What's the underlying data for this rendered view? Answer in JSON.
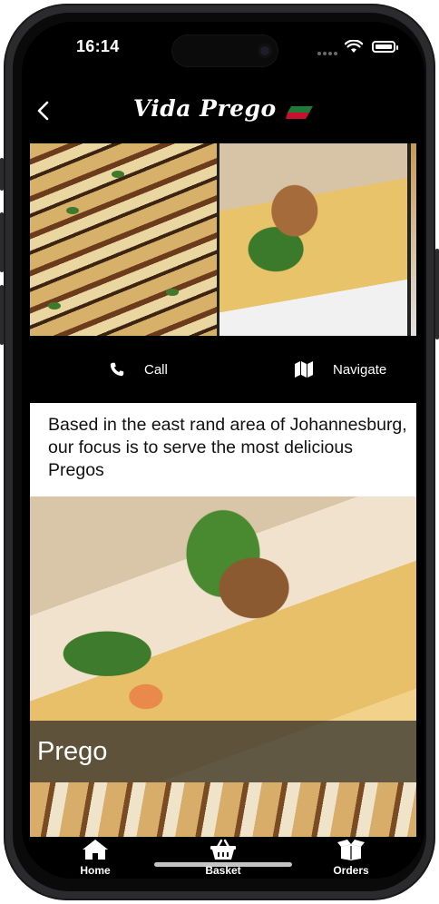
{
  "status_bar": {
    "time": "16:14"
  },
  "header": {
    "brand": "Vida Prego",
    "flag_colors": [
      "#1f7a3a",
      "#c8102e"
    ]
  },
  "actions": {
    "call_label": "Call",
    "navigate_label": "Navigate"
  },
  "about": {
    "text": "Based in the east rand area of Johannesburg, our focus is to serve the most delicious Pregos"
  },
  "categories": [
    {
      "label": "Prego"
    }
  ],
  "tabbar": {
    "home_label": "Home",
    "basket_label": "Basket",
    "orders_label": "Orders"
  }
}
